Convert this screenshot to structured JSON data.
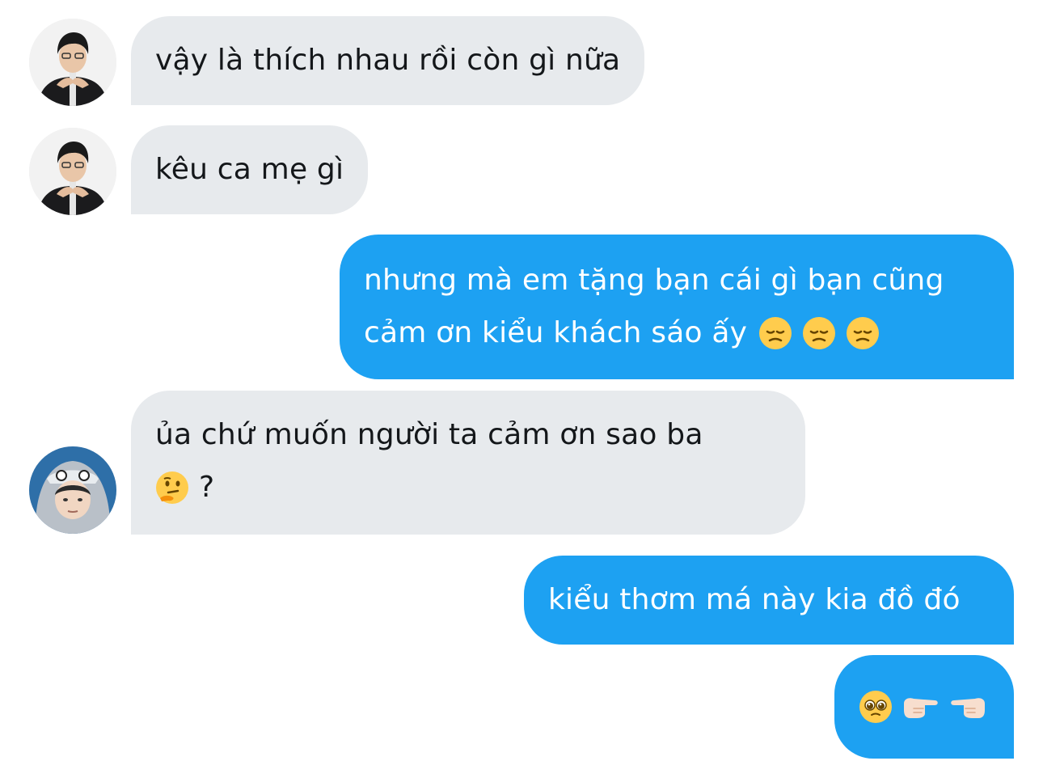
{
  "messages": [
    {
      "direction": "incoming",
      "text": "vậy là thích nhau rồi còn gì nữa"
    },
    {
      "direction": "incoming",
      "text": "kêu ca mẹ gì"
    },
    {
      "direction": "outgoing",
      "line1": "nhưng mà em tặng bạn cái gì bạn cũng",
      "line2": "cảm ơn kiểu khách sáo ấy",
      "emoji": [
        "pensive-face-emoji",
        "pensive-face-emoji",
        "pensive-face-emoji"
      ]
    },
    {
      "direction": "incoming",
      "line1": "ủa chứ muốn người ta cảm ơn sao ba",
      "line2_suffix": "?",
      "emoji": [
        "thinking-face-emoji"
      ]
    },
    {
      "direction": "outgoing",
      "text": "kiểu thơm má này kia đồ đó"
    },
    {
      "direction": "outgoing",
      "emoji": [
        "pleading-face-emoji",
        "backhand-index-pointing-right-emoji",
        "backhand-index-pointing-left-emoji"
      ]
    }
  ],
  "colors": {
    "incoming_bubble": "#e7eaed",
    "outgoing_bubble": "#1da1f2",
    "incoming_text": "#14171a",
    "outgoing_text": "#ffffff"
  }
}
